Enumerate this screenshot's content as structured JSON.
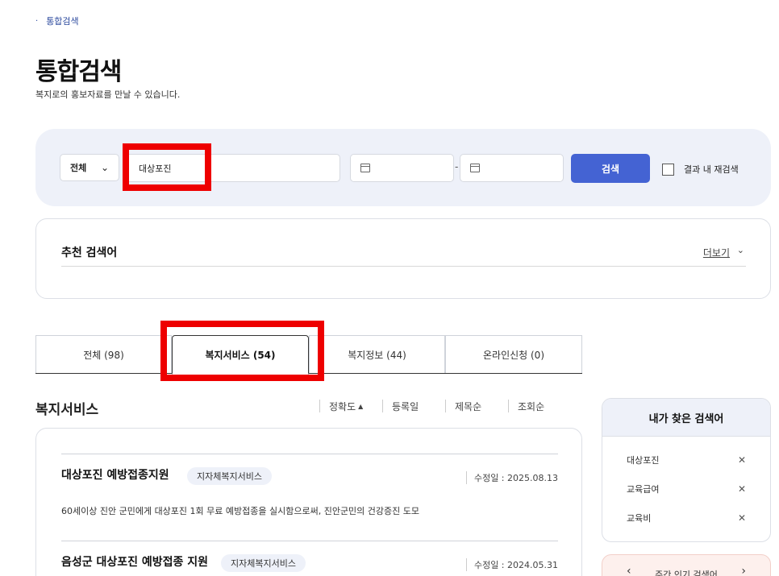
{
  "breadcrumb": {
    "dot": "·",
    "current": "통합검색"
  },
  "header": {
    "title": "통합검색",
    "description": "복지로의 홍보자료를 만날 수 있습니다."
  },
  "search": {
    "scope_selected": "전체",
    "keyword_value": "대상포진",
    "date_separator": "-",
    "button_label": "검색",
    "recheck_label": "결과 내 재검색"
  },
  "recommend": {
    "title": "추천 검색어",
    "more_label": "더보기"
  },
  "tabs": [
    {
      "label": "전체 (98)"
    },
    {
      "label": "복지서비스 (54)"
    },
    {
      "label": "복지정보 (44)"
    },
    {
      "label": "온라인신청 (0)"
    }
  ],
  "section": {
    "title": "복지서비스",
    "sort": [
      {
        "label": "정확도",
        "indicator": "▲"
      },
      {
        "label": "등록일"
      },
      {
        "label": "제목순"
      },
      {
        "label": "조회순"
      }
    ]
  },
  "results": [
    {
      "title": "대상포진 예방접종지원",
      "badge": "지자체복지서비스",
      "modified": "수정일 : 2025.08.13",
      "description": "60세이상 진안 군민에게 대상포진 1회 무료 예방접종을 실시함으로써, 진안군민의 건강증진 도모"
    },
    {
      "title": "음성군 대상포진 예방접종 지원",
      "badge": "지자체복지서비스",
      "modified": "수정일 : 2024.05.31",
      "description": ""
    }
  ],
  "history": {
    "title": "내가 찾은 검색어",
    "items": [
      {
        "label": "대상포진"
      },
      {
        "label": "교육급여"
      },
      {
        "label": "교육비"
      }
    ],
    "remove_symbol": "✕"
  },
  "popular": {
    "label": "주간 인기 검색어",
    "prev": "‹",
    "next": "›"
  },
  "colors": {
    "accent": "#4463d3",
    "highlight": "#ee0000",
    "panel": "#eef1f9"
  }
}
